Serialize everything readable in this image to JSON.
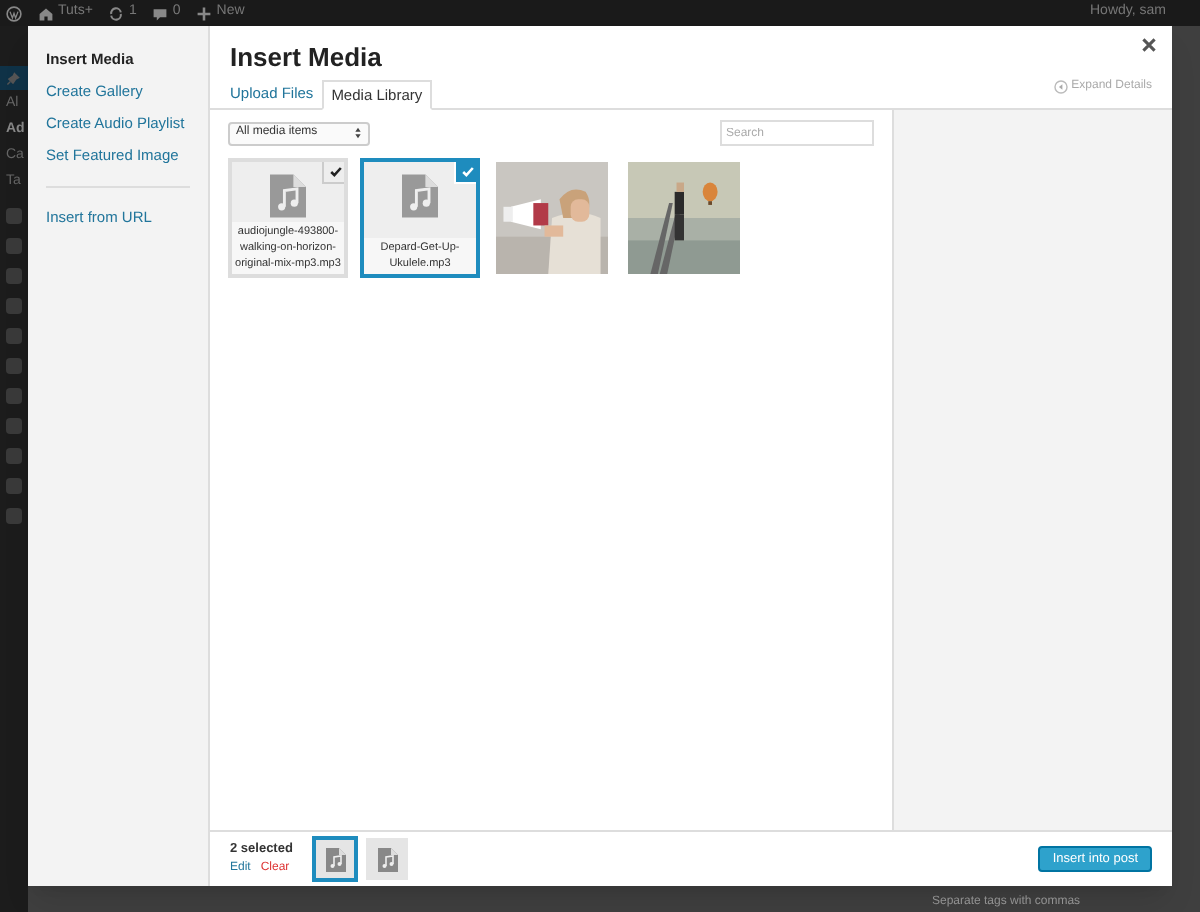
{
  "admin_bar": {
    "items": [
      {
        "kind": "logo"
      },
      {
        "kind": "home",
        "label": "Tuts+"
      },
      {
        "kind": "updates",
        "label": "1"
      },
      {
        "kind": "comments",
        "label": "0"
      },
      {
        "kind": "new",
        "label": "New"
      }
    ],
    "account": "Howdy, sam"
  },
  "admin_menu": {
    "labels": [
      "Al",
      "Ad",
      "Ca",
      "Ta"
    ]
  },
  "background_hint": "Separate tags with commas",
  "modal": {
    "menu": [
      [
        {
          "label": "Insert Media",
          "selected": true
        },
        {
          "label": "Create Gallery",
          "selected": false
        },
        {
          "label": "Create Audio Playlist",
          "selected": false
        },
        {
          "label": "Set Featured Image",
          "selected": false
        }
      ],
      [
        {
          "label": "Insert from URL",
          "selected": false
        }
      ]
    ],
    "title": "Insert Media",
    "tabs": [
      {
        "label": "Upload Files",
        "selected": false
      },
      {
        "label": "Media Library",
        "selected": true
      }
    ],
    "expand_details": "Expand Details",
    "filter": "All media items",
    "search": {
      "placeholder": "Search"
    },
    "attachments": [
      {
        "kind": "audio",
        "filename": "audiojungle-493800-walking-on-horizon-original-mix-mp3.mp3",
        "selected": true,
        "focused": false
      },
      {
        "kind": "audio",
        "filename": "Depard-Get-Up-Ukulele.mp3",
        "selected": true,
        "focused": true
      },
      {
        "kind": "picture",
        "selected": false,
        "focused": false
      },
      {
        "kind": "picture",
        "selected": false,
        "focused": false
      }
    ],
    "selection_count": "2 selected",
    "edit": "Edit",
    "clear": "Clear",
    "selection": [
      {
        "kind": "audio",
        "focused": true
      },
      {
        "kind": "audio",
        "focused": false
      }
    ],
    "insert_button": "Insert into post"
  }
}
